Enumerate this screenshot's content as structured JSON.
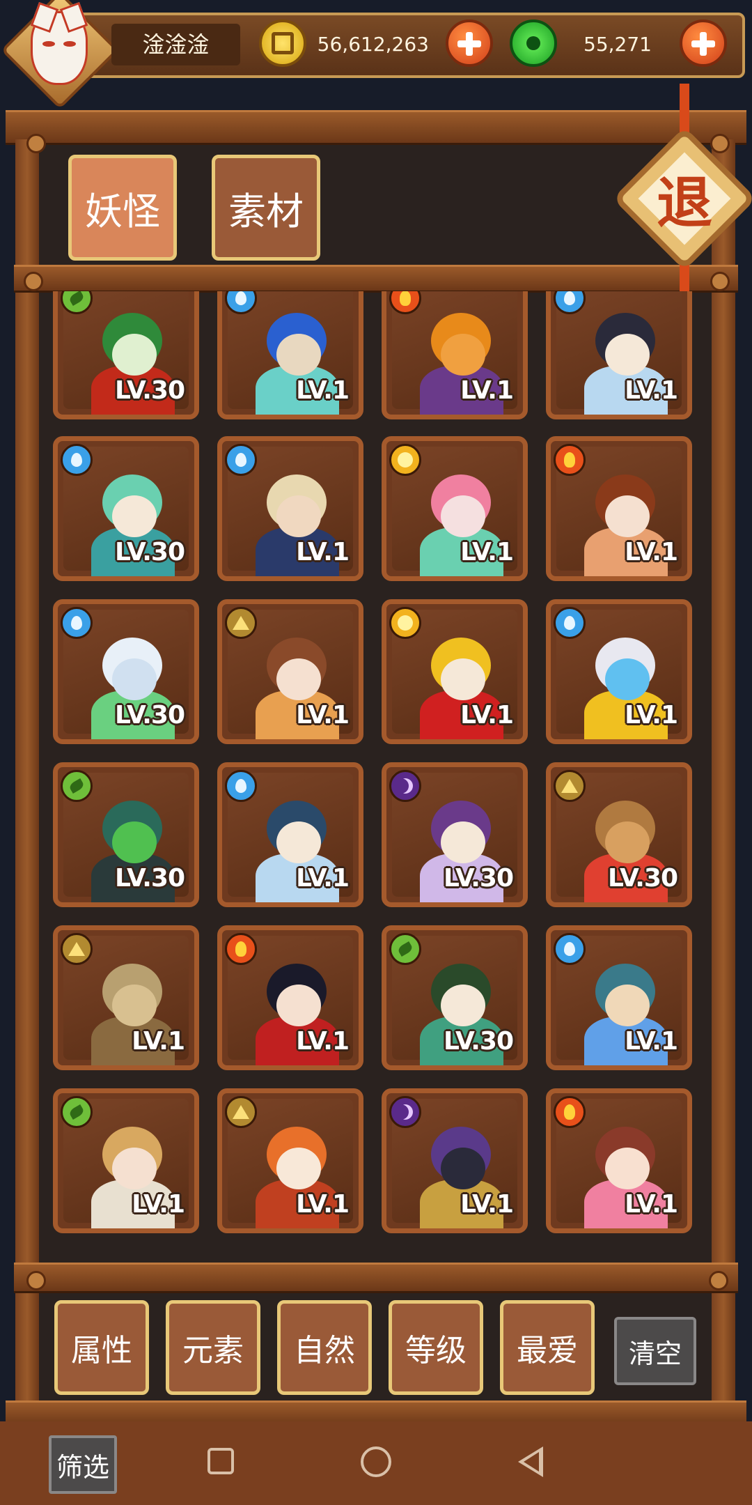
{
  "player": {
    "name": "淦淦淦"
  },
  "currencies": {
    "gold": {
      "amount": "56,612,263",
      "icon": "gold-coin-icon"
    },
    "jade": {
      "amount": "55,271",
      "icon": "jade-coin-icon"
    }
  },
  "tabs": [
    {
      "label": "妖怪",
      "active": true
    },
    {
      "label": "素材",
      "active": false
    }
  ],
  "exit": {
    "label": "退"
  },
  "cards": [
    {
      "element": "leaf",
      "level": "LV.30",
      "palette": [
        "#2f8a3a",
        "#e0f0d0",
        "#c22a1a"
      ]
    },
    {
      "element": "water",
      "level": "LV.1",
      "palette": [
        "#2a60d0",
        "#e8d8c0",
        "#6ad0c8"
      ]
    },
    {
      "element": "fire",
      "level": "LV.1",
      "palette": [
        "#e88a1a",
        "#f0a040",
        "#6a3a8a"
      ]
    },
    {
      "element": "water",
      "level": "LV.1",
      "palette": [
        "#2a2a3a",
        "#f5e8d8",
        "#b8d8f0"
      ]
    },
    {
      "element": "water",
      "level": "LV.30",
      "palette": [
        "#6ad0b0",
        "#f5e8d8",
        "#3aa0a0"
      ]
    },
    {
      "element": "water",
      "level": "LV.1",
      "palette": [
        "#e8d8b0",
        "#f0d8c0",
        "#2a3a6a"
      ]
    },
    {
      "element": "sun",
      "level": "LV.1",
      "palette": [
        "#f080a0",
        "#f5e0e0",
        "#6ad0b0"
      ]
    },
    {
      "element": "fire",
      "level": "LV.1",
      "palette": [
        "#8a3a1a",
        "#f5e0d0",
        "#e8a070"
      ]
    },
    {
      "element": "water",
      "level": "LV.30",
      "palette": [
        "#e8f0f8",
        "#d0e0f0",
        "#6ad080"
      ]
    },
    {
      "element": "earth",
      "level": "LV.1",
      "palette": [
        "#8a4a2a",
        "#f5e0d0",
        "#e8a050"
      ]
    },
    {
      "element": "sun",
      "level": "LV.1",
      "palette": [
        "#f0c020",
        "#f5e8d8",
        "#d02020"
      ]
    },
    {
      "element": "water",
      "level": "LV.1",
      "palette": [
        "#e8e8f0",
        "#60c0f0",
        "#f0c020"
      ]
    },
    {
      "element": "leaf",
      "level": "LV.30",
      "palette": [
        "#2a6a5a",
        "#50c050",
        "#2a3a3a"
      ]
    },
    {
      "element": "water",
      "level": "LV.1",
      "palette": [
        "#2a4a6a",
        "#f5e8d8",
        "#b8d8f0"
      ]
    },
    {
      "element": "moon",
      "level": "LV.30",
      "palette": [
        "#6a3a8a",
        "#f5e8d8",
        "#d0b8e8"
      ]
    },
    {
      "element": "earth",
      "level": "LV.30",
      "palette": [
        "#b07a40",
        "#d8a060",
        "#e04030"
      ]
    },
    {
      "element": "earth",
      "level": "LV.1",
      "palette": [
        "#b8a070",
        "#d8c090",
        "#8a6a40"
      ]
    },
    {
      "element": "fire",
      "level": "LV.1",
      "palette": [
        "#1a1a2a",
        "#f5e0d0",
        "#c02020"
      ]
    },
    {
      "element": "leaf",
      "level": "LV.30",
      "palette": [
        "#2a4a2a",
        "#f5e8d8",
        "#40a080"
      ]
    },
    {
      "element": "water",
      "level": "LV.1",
      "palette": [
        "#3a7a8a",
        "#f0d8b8",
        "#60a0e8"
      ]
    },
    {
      "element": "leaf",
      "level": "LV.1",
      "palette": [
        "#d8a860",
        "#f5e0d0",
        "#e8e0d0"
      ]
    },
    {
      "element": "earth",
      "level": "LV.1",
      "palette": [
        "#e8702a",
        "#f8e8d8",
        "#c04020"
      ]
    },
    {
      "element": "moon",
      "level": "LV.1",
      "palette": [
        "#5a3a8a",
        "#2a2a3a",
        "#c8a040"
      ]
    },
    {
      "element": "fire",
      "level": "LV.1",
      "palette": [
        "#8a3a2a",
        "#f8e0d0",
        "#f080a0"
      ]
    }
  ],
  "filters": [
    {
      "label": "属性"
    },
    {
      "label": "元素"
    },
    {
      "label": "自然"
    },
    {
      "label": "等级"
    },
    {
      "label": "最爱"
    }
  ],
  "clear": {
    "label": "清空"
  },
  "screen_filter": {
    "label": "筛选"
  }
}
